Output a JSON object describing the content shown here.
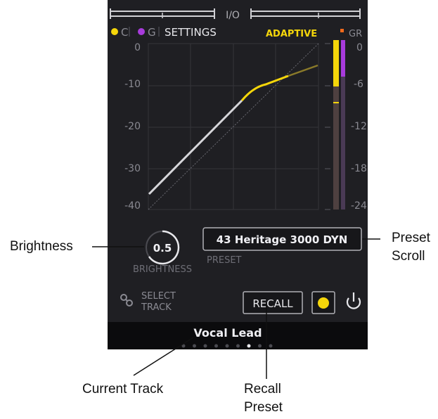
{
  "header": {
    "io_label": "I/O",
    "mode_c": "C",
    "mode_g": "G",
    "settings_label": "SETTINGS",
    "adaptive_label": "ADAPTIVE",
    "gr_label": "GR"
  },
  "graph": {
    "left_ticks": [
      "0",
      "-10",
      "-20",
      "-30",
      "-40"
    ],
    "right_ticks": [
      "0",
      "-6",
      "-12",
      "-18",
      "-24"
    ]
  },
  "brightness": {
    "value": "0.5",
    "label": "BRIGHTNESS"
  },
  "preset": {
    "name": "43 Heritage 3000 DYN",
    "label": "PRESET"
  },
  "select_track": {
    "line1": "SELECT",
    "line2": "TRACK"
  },
  "recall_label": "RECALL",
  "track": {
    "name": "Vocal Lead",
    "page_count": 9,
    "active_page": 7
  },
  "callouts": {
    "brightness": "Brightness",
    "preset_scroll_1": "Preset",
    "preset_scroll_2": "Scroll",
    "current_track": "Current Track",
    "recall_preset_1": "Recall",
    "recall_preset_2": "Preset"
  },
  "colors": {
    "panel": "#1f1f23",
    "accent_yellow": "#f5d60a",
    "accent_purple": "#a83bdc",
    "gr_orange": "#f26a1b",
    "text_grey": "#8a8a92"
  }
}
